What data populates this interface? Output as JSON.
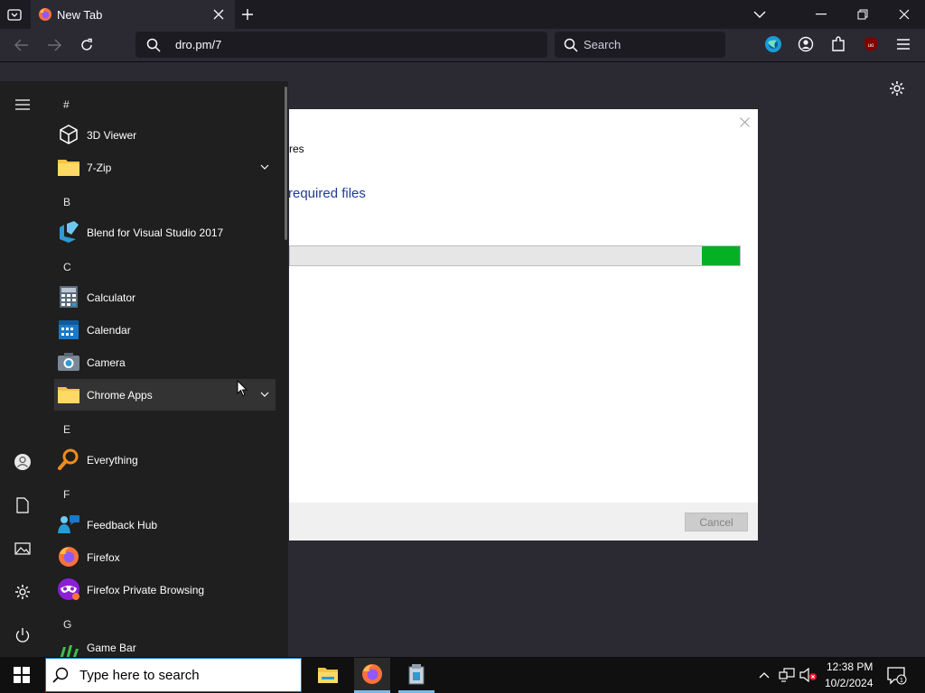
{
  "browser": {
    "tab_title": "New Tab",
    "url": "dro.pm/7",
    "search_placeholder": "Search",
    "extension_badge": "uo"
  },
  "installer": {
    "subtitle_partial": "res",
    "heading_partial": "required files",
    "progress_fraction": 0.085,
    "cancel_label": "Cancel"
  },
  "start_menu": {
    "sections": [
      {
        "letter": "#",
        "apps": [
          {
            "label": "3D Viewer",
            "icon": "cube-icon"
          },
          {
            "label": "7-Zip",
            "icon": "folder-icon",
            "expandable": true
          }
        ]
      },
      {
        "letter": "B",
        "apps": [
          {
            "label": "Blend for Visual Studio 2017",
            "icon": "blend-icon"
          }
        ]
      },
      {
        "letter": "C",
        "apps": [
          {
            "label": "Calculator",
            "icon": "calculator-icon"
          },
          {
            "label": "Calendar",
            "icon": "calendar-icon"
          },
          {
            "label": "Camera",
            "icon": "camera-icon"
          },
          {
            "label": "Chrome Apps",
            "icon": "folder-icon",
            "expandable": true,
            "hovered": true
          }
        ]
      },
      {
        "letter": "E",
        "apps": [
          {
            "label": "Everything",
            "icon": "search-magnifier-icon"
          }
        ]
      },
      {
        "letter": "F",
        "apps": [
          {
            "label": "Feedback Hub",
            "icon": "feedback-icon"
          },
          {
            "label": "Firefox",
            "icon": "firefox-icon"
          },
          {
            "label": "Firefox Private Browsing",
            "icon": "private-mask-icon"
          }
        ]
      },
      {
        "letter": "G",
        "apps": [
          {
            "label": "Game Bar",
            "icon": "gamebar-icon"
          }
        ]
      }
    ]
  },
  "taskbar": {
    "search_placeholder": "Type here to search",
    "time": "12:38 PM",
    "date": "10/2/2024",
    "notification_count": "1"
  }
}
